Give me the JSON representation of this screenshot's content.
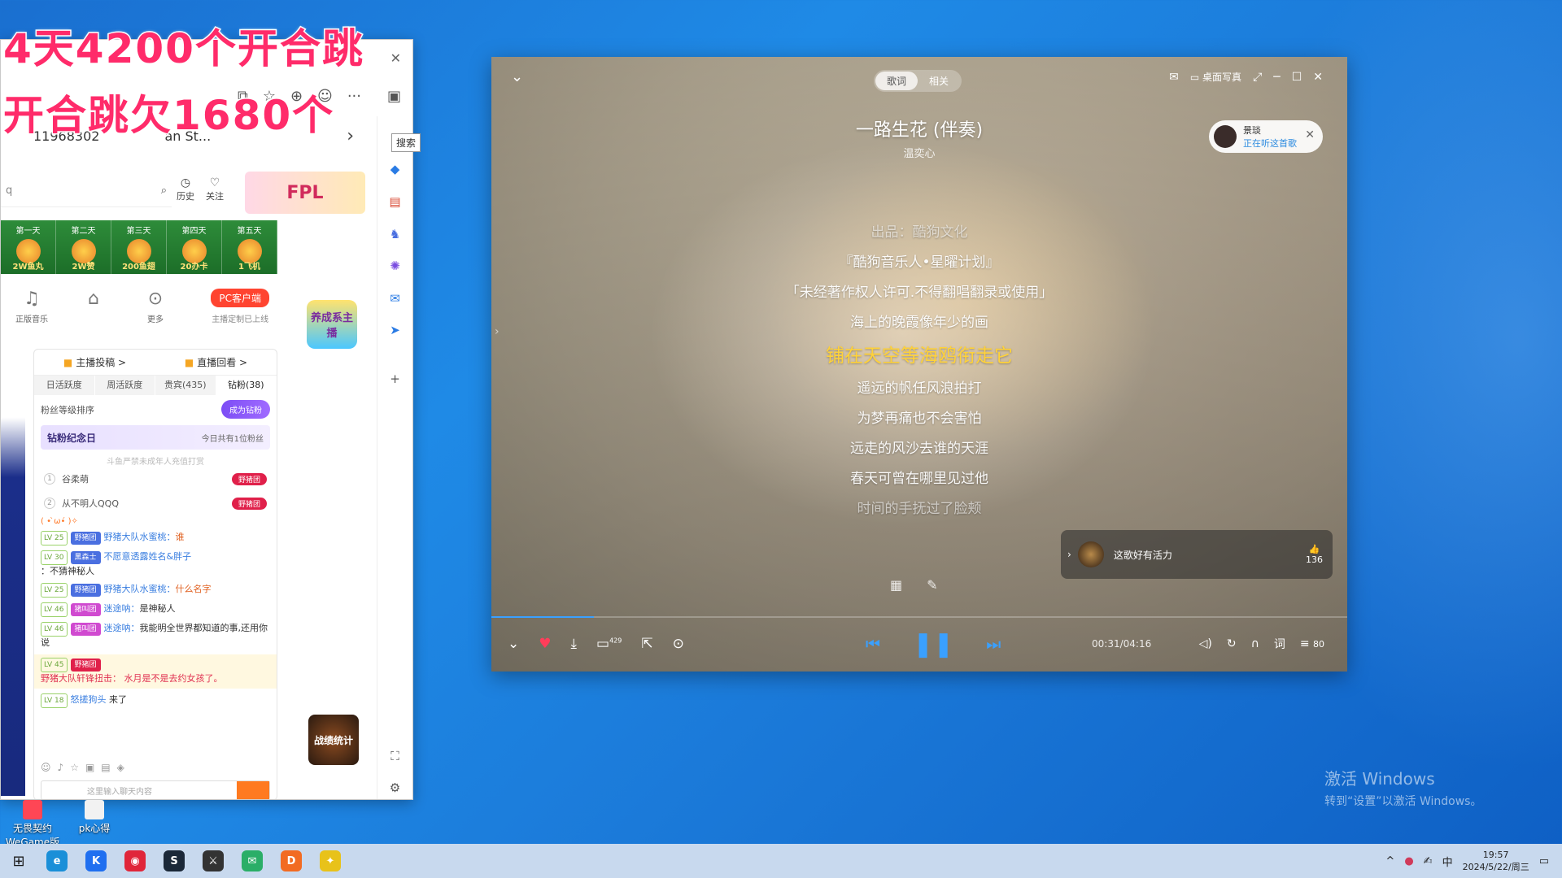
{
  "overlay": {
    "line1": "4天4200个开合跳",
    "line2": "开合跳欠1680个"
  },
  "desktop": {
    "icons": [
      {
        "label": "无畏契约 WeGame版"
      },
      {
        "label": "pk心得"
      }
    ],
    "activate_title": "激活 Windows",
    "activate_sub": "转到“设置”以激活 Windows。"
  },
  "browser": {
    "address_fragment": "11968302",
    "address_tail": "an St...",
    "search_placeholder": "q",
    "tooltip": "搜索",
    "history_label": "历史",
    "follow_label": "关注",
    "fpl_banner": "FPL",
    "days": [
      {
        "label": "第一天",
        "amount": "2W鱼丸"
      },
      {
        "label": "第二天",
        "amount": "2W赞"
      },
      {
        "label": "第三天",
        "amount": "200鱼翅"
      },
      {
        "label": "第四天",
        "amount": "20办卡"
      },
      {
        "label": "第五天",
        "amount": "1飞机"
      }
    ],
    "quick": [
      {
        "label": "正版音乐",
        "icon": "music-icon"
      },
      {
        "label": "",
        "icon": "gift-icon"
      },
      {
        "label": "更多",
        "icon": "more-icon"
      }
    ],
    "pc_client_btn": "PC客户端",
    "pc_client_sub": "主播定制已上线",
    "mascot_text": "养成系主播",
    "warbook_text": "战绩统计",
    "chat": {
      "top_tabs": [
        "主播投稿 >",
        "直播回看 >"
      ],
      "rank_tabs": [
        "日活跃度",
        "周活跃度",
        "贵宾(435)",
        "钻粉(38)"
      ],
      "fan_sort_label": "粉丝等级排序",
      "become_btn": "成为钻粉",
      "anniv_title": "钻粉纪念日",
      "anniv_count": "今日共有1位粉丝",
      "notice": "斗鱼严禁未成年人充值打赏",
      "ranks": [
        {
          "num": "1",
          "name": "谷柔萌",
          "badge": "野猪团"
        },
        {
          "num": "2",
          "name": "从不明人QQQ",
          "badge": "野猪团"
        }
      ],
      "system_msg": "( • ̀ω•́ )✧",
      "messages": [
        {
          "lv": "LV 25",
          "badge": "野猪团",
          "nick": "野猪大队水蜜桃：",
          "text": "谁"
        },
        {
          "lv": "LV 30",
          "badge": "黑森士",
          "nick": "不愿意透露姓名&胖子",
          "text": "：不猜神秘人"
        },
        {
          "lv": "LV 25",
          "badge": "野猪团",
          "nick": "野猪大队水蜜桃：",
          "text": "什么名字"
        },
        {
          "lv": "LV 46",
          "badge": "猪叫团",
          "nick": "迷途呐：",
          "text": "是神秘人"
        },
        {
          "lv": "LV 46",
          "badge": "猪叫团",
          "nick": "迷途呐：",
          "text": "我能明全世界都知道的事,还用你说"
        }
      ],
      "highlight_msg": {
        "lv": "LV 45",
        "badge": "野猪团",
        "text": "野猪大队轩锋扭击： 水月是不是去约女孩了。"
      },
      "last_msg": {
        "lv": "LV 18",
        "nick": "怒搓狗头",
        "text": "来了"
      },
      "input_placeholder": "这里输入聊天内容"
    }
  },
  "player": {
    "tabs": [
      "歌词",
      "相关"
    ],
    "active_tab": 0,
    "desktop_lyrics": "桌面写真",
    "title": "一路生花 (伴奏)",
    "artist": "温奕心",
    "listener_name": "景琰",
    "listener_status": "正在听这首歌",
    "lyrics": [
      {
        "text": "出品：酷狗文化",
        "state": "dim"
      },
      {
        "text": "『酷狗音乐人•星曜计划』",
        "state": "normal"
      },
      {
        "text": "「未经著作权人许可.不得翻唱翻录或使用」",
        "state": "normal"
      },
      {
        "text": "海上的晚霞像年少的画",
        "state": "normal"
      },
      {
        "text": "铺在天空等海鸥衔走它",
        "state": "current"
      },
      {
        "text": "遥远的帆任风浪拍打",
        "state": "normal"
      },
      {
        "text": "为梦再痛也不会害怕",
        "state": "normal"
      },
      {
        "text": "远走的风沙去谁的天涯",
        "state": "normal"
      },
      {
        "text": "春天可曾在哪里见过他",
        "state": "normal"
      },
      {
        "text": "时间的手抚过了脸颊",
        "state": "dim"
      }
    ],
    "comment_text": "这歌好有活力",
    "comment_likes": "136",
    "comment_count": "429",
    "time": "00:31/04:16",
    "progress": 0.12,
    "lyrics_btn": "词",
    "playlist_count": "80"
  },
  "taskbar": {
    "apps": [
      {
        "icon": "edge-icon",
        "color": "#1a8fd8",
        "glyph": "e"
      },
      {
        "icon": "kugou-icon",
        "color": "#1f6ff0",
        "glyph": "K"
      },
      {
        "icon": "netease-icon",
        "color": "#e0263a",
        "glyph": "◉"
      },
      {
        "icon": "steam-icon",
        "color": "#1b2838",
        "glyph": "S"
      },
      {
        "icon": "app-icon",
        "color": "#333333",
        "glyph": "⚔"
      },
      {
        "icon": "wechat-icon",
        "color": "#2aae67",
        "glyph": "✉"
      },
      {
        "icon": "douyu-icon",
        "color": "#f26b22",
        "glyph": "D"
      },
      {
        "icon": "game-icon",
        "color": "#e8c21a",
        "glyph": "✦"
      }
    ],
    "ime": "中",
    "time": "19:57",
    "date": "2024/5/22/周三"
  }
}
